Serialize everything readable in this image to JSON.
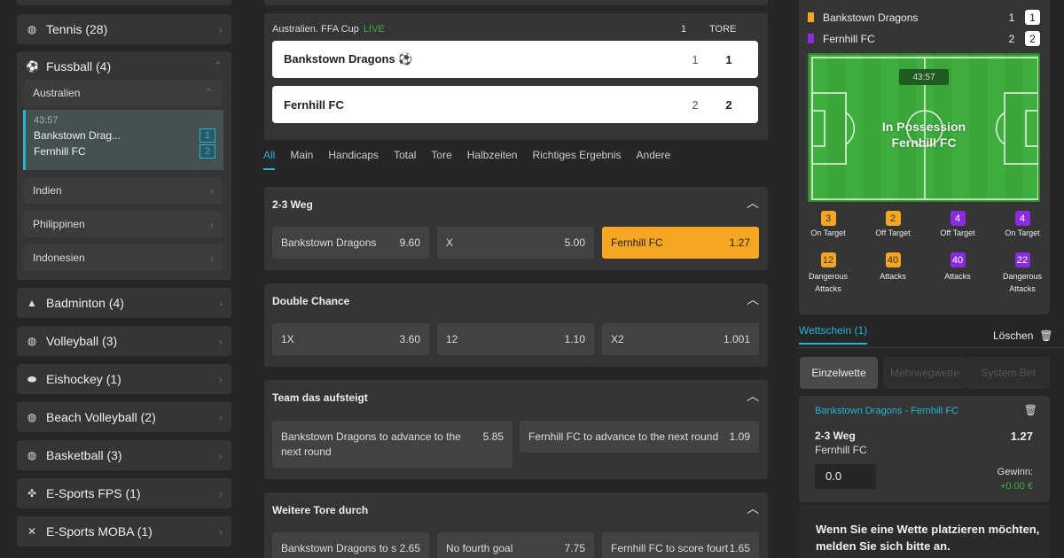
{
  "sidebar": {
    "tennis": "Tennis (28)",
    "fussball": "Fussball (4)",
    "australien": "Australien",
    "live": {
      "time": "43:57",
      "home": "Bankstown Drag...",
      "away": "Fernhill FC",
      "home_score": "1",
      "away_score": "2"
    },
    "indien": "Indien",
    "philippinen": "Philippinen",
    "indonesien": "Indonesien",
    "badminton": "Badminton (4)",
    "volleyball": "Volleyball (3)",
    "eishockey": "Eishockey (1)",
    "beach": "Beach Volleyball (2)",
    "basketball": "Basketball (3)",
    "esports_fps": "E-Sports FPS (1)",
    "esports_moba": "E-Sports MOBA (1)"
  },
  "match": {
    "league": "Australien. FFA Cup",
    "live": "LIVE",
    "col1": "1",
    "col2": "TORE",
    "home": "Bankstown Dragons",
    "home_ball": "⚽",
    "home_p1": "1",
    "home_goals": "1",
    "away": "Fernhill FC",
    "away_p1": "2",
    "away_goals": "2"
  },
  "tabs": [
    "All",
    "Main",
    "Handicaps",
    "Total",
    "Tore",
    "Halbzeiten",
    "Richtiges Ergebnis",
    "Andere"
  ],
  "markets": {
    "m1": {
      "title": "2-3 Weg",
      "o1n": "Bankstown Dragons",
      "o1v": "9.60",
      "o2n": "X",
      "o2v": "5.00",
      "o3n": "Fernhill FC",
      "o3v": "1.27"
    },
    "m2": {
      "title": "Double Chance",
      "o1n": "1X",
      "o1v": "3.60",
      "o2n": "12",
      "o2v": "1.10",
      "o3n": "X2",
      "o3v": "1.001"
    },
    "m3": {
      "title": "Team das aufsteigt",
      "o1n": "Bankstown Dragons to advance to the next round",
      "o1v": "5.85",
      "o2n": "Fernhill FC to advance to the next round",
      "o2v": "1.09"
    },
    "m4": {
      "title": "Weitere Tore durch",
      "o1n": "Bankstown Dragons to s",
      "o1v": "2.65",
      "o2n": "No fourth goal",
      "o2v": "7.75",
      "o3n": "Fernhill FC to score fourt",
      "o3v": "1.65"
    }
  },
  "stats": {
    "home": "Bankstown Dragons",
    "home_p1": "1",
    "home_score": "1",
    "away": "Fernhill FC",
    "away_p1": "2",
    "away_score": "2",
    "clock": "43:57",
    "possession": "In Possession",
    "possession_team": "Fernhill FC",
    "items": [
      {
        "v": "3",
        "l": "On Target"
      },
      {
        "v": "2",
        "l": "Off Target"
      },
      {
        "v": "4",
        "l": "Off Target"
      },
      {
        "v": "4",
        "l": "On Target"
      },
      {
        "v": "12",
        "l": "Dangerous Attacks"
      },
      {
        "v": "40",
        "l": "Attacks"
      },
      {
        "v": "40",
        "l": "Attacks"
      },
      {
        "v": "22",
        "l": "Dangerous Attacks"
      }
    ],
    "home_color": "#f5a623",
    "away_color": "#8a2be2"
  },
  "betslip": {
    "title": "Wettschein (1)",
    "clear": "Löschen",
    "tab_single": "Einzelwette",
    "tab_multi": "Mehrwegwette",
    "tab_system": "System Bet",
    "match": "Bankstown Dragons - Fernhill FC",
    "market": "2-3 Weg",
    "pick": "Fernhill FC",
    "odds": "1.27",
    "stake": "0.0",
    "win_label": "Gewinn:",
    "win_value": "+0.00 €",
    "login_msg": "Wenn Sie eine Wette platzieren möchten, melden Sie sich bitte an."
  }
}
